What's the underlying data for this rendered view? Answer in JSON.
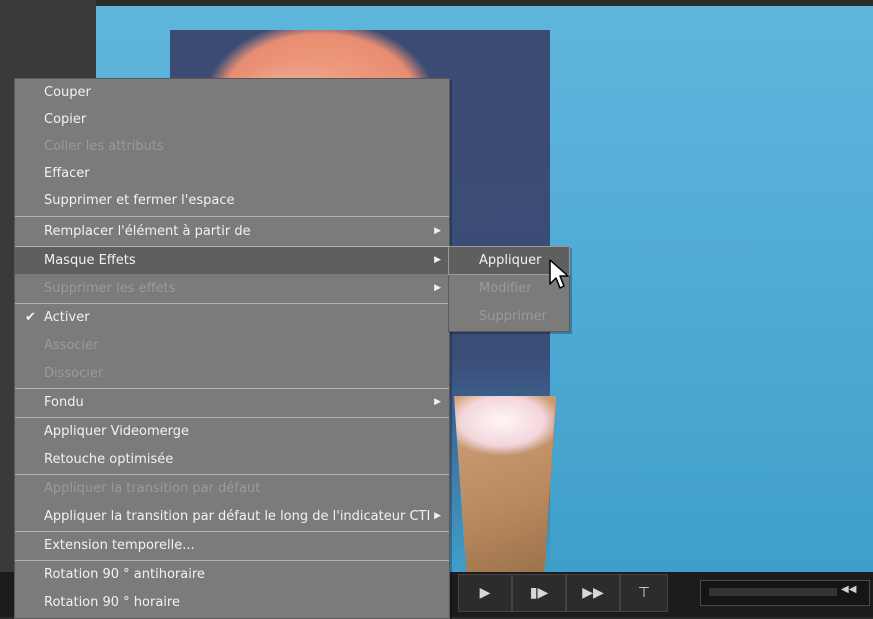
{
  "menu": {
    "items": [
      {
        "label": "Couper",
        "enabled": true
      },
      {
        "label": "Copier",
        "enabled": true
      },
      {
        "label": "Coller les attributs",
        "enabled": false
      },
      {
        "label": "Effacer",
        "enabled": true
      },
      {
        "label": "Supprimer et fermer l'espace",
        "enabled": true
      },
      {
        "label": "Remplacer l'élément à partir de",
        "enabled": true,
        "submenu": true
      },
      {
        "label": "Masque Effets",
        "enabled": true,
        "submenu": true,
        "highlighted": true
      },
      {
        "label": "Supprimer les effets",
        "enabled": false,
        "submenu": true
      },
      {
        "label": "Activer",
        "enabled": true,
        "checked": true
      },
      {
        "label": "Associer",
        "enabled": false
      },
      {
        "label": "Dissocier",
        "enabled": false
      },
      {
        "label": "Fondu",
        "enabled": true,
        "submenu": true
      },
      {
        "label": "Appliquer Videomerge",
        "enabled": true
      },
      {
        "label": "Retouche optimisée",
        "enabled": true
      },
      {
        "label": "Appliquer la transition par défaut",
        "enabled": false
      },
      {
        "label": "Appliquer la transition par défaut le long de l'indicateur CTI",
        "enabled": true,
        "submenu": true
      },
      {
        "label": "Extension temporelle...",
        "enabled": true
      },
      {
        "label": "Rotation 90 ° antihoraire",
        "enabled": true
      },
      {
        "label": "Rotation 90 ° horaire",
        "enabled": true
      }
    ]
  },
  "submenu": {
    "items": [
      {
        "label": "Appliquer",
        "enabled": true,
        "highlighted": true
      },
      {
        "label": "Modifier",
        "enabled": false
      },
      {
        "label": "Supprimer",
        "enabled": false
      }
    ]
  },
  "playback": {
    "buttons": [
      "play-icon",
      "step-forward-icon",
      "fast-forward-icon",
      "trim-icon"
    ]
  },
  "icons": {
    "check": "✔",
    "submenu_arrow": "▶"
  }
}
